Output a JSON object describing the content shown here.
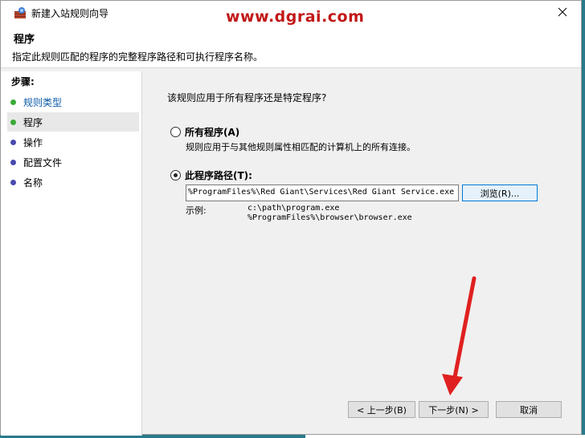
{
  "window": {
    "title": "新建入站规则向导",
    "watermark": "www.dgrai.com"
  },
  "header": {
    "title": "程序",
    "description": "指定此规则匹配的程序的完整程序路径和可执行程序名称。"
  },
  "sidebar": {
    "steps_label": "步骤:",
    "items": [
      {
        "label": "规则类型",
        "bullet": "green",
        "state": "done"
      },
      {
        "label": "程序",
        "bullet": "green",
        "state": "current"
      },
      {
        "label": "操作",
        "bullet": "blue",
        "state": "pending"
      },
      {
        "label": "配置文件",
        "bullet": "blue",
        "state": "pending"
      },
      {
        "label": "名称",
        "bullet": "blue",
        "state": "pending"
      }
    ]
  },
  "main": {
    "question": "该规则应用于所有程序还是特定程序?",
    "all_programs": {
      "label": "所有程序(A)",
      "description": "规则应用于与其他规则属性相匹配的计算机上的所有连接。",
      "checked": false
    },
    "this_program": {
      "label": "此程序路径(T):",
      "checked": true
    },
    "path_value": "%ProgramFiles%\\Red Giant\\Services\\Red Giant Service.exe",
    "browse_label": "浏览(R)...",
    "example_label": "示例:",
    "example_lines": [
      "c:\\path\\program.exe",
      "%ProgramFiles%\\browser\\browser.exe"
    ]
  },
  "buttons": {
    "back": "< 上一步(B)",
    "next": "下一步(N) >",
    "cancel": "取消"
  },
  "colors": {
    "watermark": "#c21818",
    "arrow": "#e02020",
    "bullet_green": "#3aaa35",
    "bullet_blue": "#4a4ab0",
    "link": "#0b5aa8",
    "focus_border": "#0078d7"
  },
  "icons": {
    "title": "firewall-wizard-icon",
    "close": "close-icon"
  }
}
